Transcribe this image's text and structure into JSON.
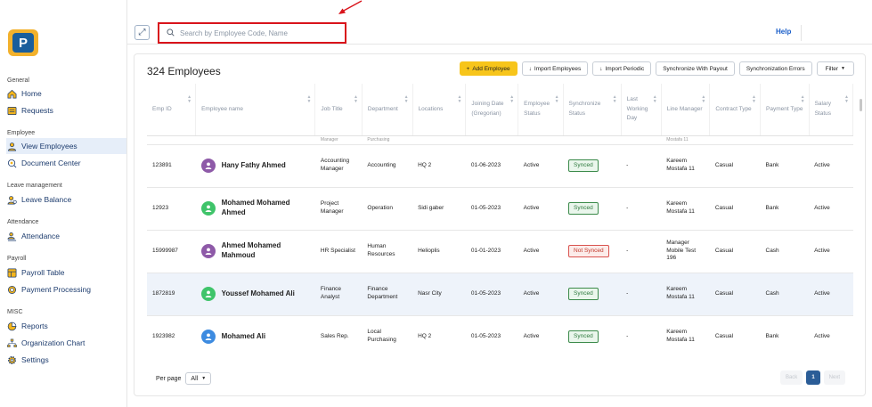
{
  "sidebar": {
    "sections": [
      {
        "label": "General",
        "items": [
          {
            "label": "Home",
            "icon": "home-icon",
            "active": false
          },
          {
            "label": "Requests",
            "icon": "requests-icon",
            "active": false
          }
        ]
      },
      {
        "label": "Employee",
        "items": [
          {
            "label": "View Employees",
            "icon": "employees-icon",
            "active": true
          },
          {
            "label": "Document Center",
            "icon": "document-icon",
            "active": false
          }
        ]
      },
      {
        "label": "Leave management",
        "items": [
          {
            "label": "Leave Balance",
            "icon": "leave-icon",
            "active": false
          }
        ]
      },
      {
        "label": "Attendance",
        "items": [
          {
            "label": "Attendance",
            "icon": "attendance-icon",
            "active": false
          }
        ]
      },
      {
        "label": "Payroll",
        "items": [
          {
            "label": "Payroll Table",
            "icon": "payroll-icon",
            "active": false
          },
          {
            "label": "Payment Processing",
            "icon": "payment-icon",
            "active": false
          }
        ]
      },
      {
        "label": "MISC",
        "items": [
          {
            "label": "Reports",
            "icon": "reports-icon",
            "active": false
          },
          {
            "label": "Organization Chart",
            "icon": "org-chart-icon",
            "active": false
          },
          {
            "label": "Settings",
            "icon": "settings-icon",
            "active": false
          }
        ]
      }
    ]
  },
  "topbar": {
    "search_placeholder": "Search by Employee Code, Name",
    "help_label": "Help"
  },
  "main": {
    "title": "324 Employees",
    "toolbar": {
      "add_label": "Add Employee",
      "import_employees_label": "Import Employees",
      "import_periodic_label": "Import Periodic",
      "sync_payout_label": "Synchronize With Payout",
      "sync_errors_label": "Synchronization Errors",
      "filter_label": "Filter"
    },
    "columns": [
      "Emp ID",
      "Employee name",
      "Job Title",
      "Department",
      "Locations",
      "Joining Date (Gregorian)",
      "Employee Status",
      "Synchronize Status",
      "Last Working Day",
      "Line Manager",
      "Contract Type",
      "Payment Type",
      "Salary Status"
    ],
    "partial_row": [
      "",
      "",
      "Manager",
      "Purchasing",
      "",
      "",
      "",
      "",
      "",
      "Mostafa 11",
      "",
      "",
      ""
    ],
    "rows": [
      {
        "emp_id": "123891",
        "name": "Hany Fathy Ahmed",
        "avatar_color": "#8e5aa8",
        "job_title": "Accounting Manager",
        "department": "Accounting",
        "location": "HQ 2",
        "joining_date": "01-06-2023",
        "status": "Active",
        "sync": "Synced",
        "synced": true,
        "last_day": "-",
        "manager": "Kareem Mostafa 11",
        "contract": "Casual",
        "payment": "Bank",
        "salary": "Active",
        "highlight": false
      },
      {
        "emp_id": "12923",
        "name": "Mohamed Mohamed Ahmed",
        "avatar_color": "#3fc46a",
        "job_title": "Project Manager",
        "department": "Operation",
        "location": "Sidi gaber",
        "joining_date": "01-05-2023",
        "status": "Active",
        "sync": "Synced",
        "synced": true,
        "last_day": "-",
        "manager": "Kareem Mostafa 11",
        "contract": "Casual",
        "payment": "Bank",
        "salary": "Active",
        "highlight": false
      },
      {
        "emp_id": "15999987",
        "name": "Ahmed Mohamed Mahmoud",
        "avatar_color": "#8e5aa8",
        "job_title": "HR Specialist",
        "department": "Human Resources",
        "location": "Helioplis",
        "joining_date": "01-01-2023",
        "status": "Active",
        "sync": "Not Synced",
        "synced": false,
        "last_day": "-",
        "manager": "Manager Mobile Test 196",
        "contract": "Casual",
        "payment": "Cash",
        "salary": "Active",
        "highlight": false
      },
      {
        "emp_id": "1872819",
        "name": "Youssef Mohamed Ali",
        "avatar_color": "#3fc46a",
        "job_title": "Finance Analyst",
        "department": "Finance Department",
        "location": "Nasr City",
        "joining_date": "01-05-2023",
        "status": "Active",
        "sync": "Synced",
        "synced": true,
        "last_day": "-",
        "manager": "Kareem Mostafa 11",
        "contract": "Casual",
        "payment": "Cash",
        "salary": "Active",
        "highlight": true
      },
      {
        "emp_id": "1923982",
        "name": "Mohamed Ali",
        "avatar_color": "#3d8be0",
        "job_title": "Sales Rep.",
        "department": "Local Purchasing",
        "location": "HQ 2",
        "joining_date": "01-05-2023",
        "status": "Active",
        "sync": "Synced",
        "synced": true,
        "last_day": "-",
        "manager": "Kareem Mostafa 11",
        "contract": "Casual",
        "payment": "Bank",
        "salary": "Active",
        "highlight": false
      }
    ],
    "pagination": {
      "per_page_label": "Per page",
      "per_page_value": "All",
      "back_label": "Back",
      "current_page": "1",
      "next_label": "Next"
    }
  },
  "colors": {
    "accent": "#f7c51b",
    "primary_blue": "#2b5d97",
    "highlight_red": "#d9141b"
  }
}
